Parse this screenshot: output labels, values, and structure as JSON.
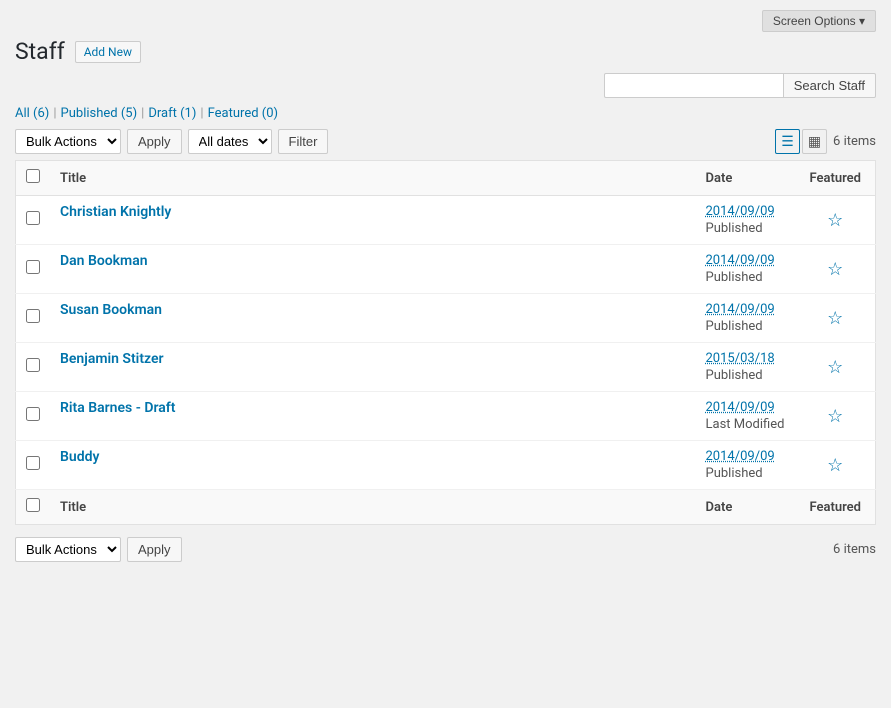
{
  "screen_options": {
    "label": "Screen Options ▾"
  },
  "page": {
    "title": "Staff",
    "add_new_label": "Add New"
  },
  "filters": {
    "all_label": "All",
    "all_count": "(6)",
    "published_label": "Published",
    "published_count": "(5)",
    "draft_label": "Draft",
    "draft_count": "(1)",
    "featured_label": "Featured",
    "featured_count": "(0)"
  },
  "toolbar": {
    "bulk_actions_label": "Bulk Actions",
    "apply_label": "Apply",
    "dates_placeholder": "All dates",
    "filter_label": "Filter",
    "items_count": "6 items",
    "view_list_icon": "≡",
    "view_grid_icon": "⊞"
  },
  "search": {
    "placeholder": "",
    "button_label": "Search Staff"
  },
  "table": {
    "col_title": "Title",
    "col_date": "Date",
    "col_featured": "Featured",
    "rows": [
      {
        "id": 1,
        "title": "Christian Knightly",
        "date": "2014/09/09",
        "status": "Published"
      },
      {
        "id": 2,
        "title": "Dan Bookman",
        "date": "2014/09/09",
        "status": "Published"
      },
      {
        "id": 3,
        "title": "Susan Bookman",
        "date": "2014/09/09",
        "status": "Published"
      },
      {
        "id": 4,
        "title": "Benjamin Stitzer",
        "date": "2015/03/18",
        "status": "Published"
      },
      {
        "id": 5,
        "title": "Rita Barnes - Draft",
        "date": "2014/09/09",
        "status": "Last Modified"
      },
      {
        "id": 6,
        "title": "Buddy",
        "date": "2014/09/09",
        "status": "Published"
      }
    ]
  },
  "bottom": {
    "bulk_actions_label": "Bulk Actions",
    "apply_label": "Apply",
    "items_count": "6 items"
  }
}
